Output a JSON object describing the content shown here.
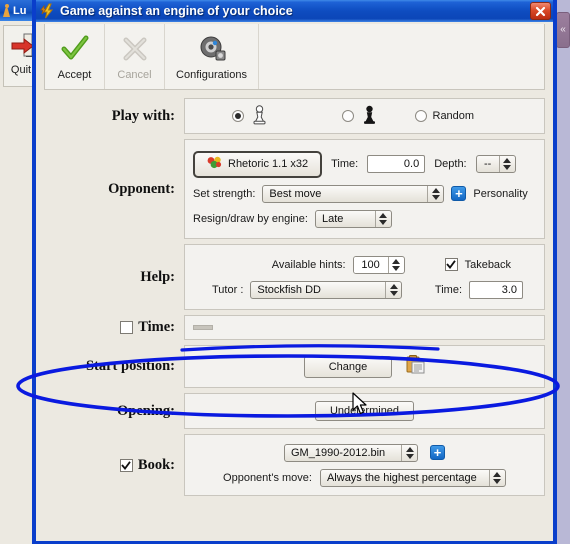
{
  "background_window": {
    "title": "Lu",
    "quit_label": "Quit",
    "quit_icon": "exit-arrow-icon",
    "pawn_icon": "pawn-icon",
    "right_chip": "«"
  },
  "dialog": {
    "title": "Game against an engine of your choice",
    "title_icon": "lightning-bolt-icon",
    "close_label": "✕",
    "toolbar": {
      "accept_label": "Accept",
      "accept_icon": "checkmark-icon",
      "cancel_label": "Cancel",
      "cancel_icon": "cross-icon",
      "configurations_label": "Configurations",
      "configurations_icon": "gear-icon"
    },
    "play_with": {
      "label": "Play with:",
      "options": [
        {
          "value": "white",
          "icon": "white-pawn-icon",
          "label": "",
          "selected": true
        },
        {
          "value": "black",
          "icon": "black-pawn-icon",
          "label": "",
          "selected": false
        },
        {
          "value": "random",
          "icon": "",
          "label": "Random",
          "selected": false
        }
      ]
    },
    "opponent": {
      "label": "Opponent:",
      "engine_name": "Rhetoric 1.1 x32",
      "engine_icon": "engine-heart-icon",
      "time_label": "Time:",
      "time_value": "0.0",
      "depth_label": "Depth:",
      "depth_value": "--",
      "set_strength_label": "Set strength:",
      "set_strength_value": "Best move",
      "personality_label": "Personality",
      "personality_icon": "plus-icon",
      "resign_label": "Resign/draw by engine:",
      "resign_value": "Late"
    },
    "help": {
      "label": "Help:",
      "hints_label": "Available hints:",
      "hints_value": "100",
      "takeback_label": "Takeback",
      "takeback_checked": true,
      "tutor_label": "Tutor :",
      "tutor_value": "Stockfish DD",
      "time_label": "Time:",
      "time_value": "3.0"
    },
    "time": {
      "label": "Time:",
      "checked": false
    },
    "start_position": {
      "label": "Start position:",
      "change_label": "Change",
      "paste_icon": "clipboard-paste-icon"
    },
    "opening": {
      "label": "Opening:",
      "value_label": "Undetermined"
    },
    "book": {
      "label": "Book:",
      "checked": true,
      "file_value": "GM_1990-2012.bin",
      "add_icon": "plus-icon",
      "opponent_move_label": "Opponent's move:",
      "opponent_move_value": "Always the highest percentage"
    }
  },
  "annotations": {
    "ellipse_color": "#0a1ae0",
    "line_color": "#0a1ae0"
  }
}
